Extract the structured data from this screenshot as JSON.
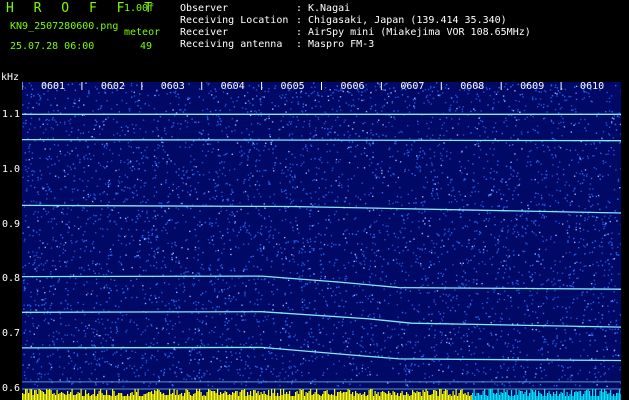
{
  "header": {
    "title": "H R O F F T",
    "version": "1.00f",
    "filename": "KN9_2507280600.png",
    "meteor_label": "meteor",
    "datetime": "25.07.28 06:00",
    "meteor_count": "49"
  },
  "info": [
    {
      "label": "Observer",
      "value": "K.Nagai"
    },
    {
      "label": "Receiving Location",
      "value": "Chigasaki, Japan (139.414 35.340)"
    },
    {
      "label": "Receiver",
      "value": "AirSpy mini (Miakejima VOR 108.65MHz)"
    },
    {
      "label": "Receiving antenna",
      "value": "Maspro FM-3"
    }
  ],
  "separator": ":",
  "chart_data": {
    "type": "heatmap",
    "ylabel": "kHz",
    "yticks": [
      "1.1",
      "1.0",
      "0.9",
      "0.8",
      "0.7",
      "0.6"
    ],
    "xticks": [
      "0601",
      "0602",
      "0603",
      "0604",
      "0605",
      "0606",
      "0607",
      "0608",
      "0609",
      "0610"
    ],
    "ylim": [
      0.58,
      1.16
    ],
    "colors": {
      "background": "#000a66",
      "noise": "#2a6bff",
      "trace": "#8ef6ff",
      "bar": "#ffff00",
      "bar_end": "#00e5ff"
    },
    "traces_khz": [
      {
        "points": [
          [
            0,
            1.101
          ],
          [
            10,
            1.101
          ]
        ]
      },
      {
        "points": [
          [
            0,
            1.055
          ],
          [
            10,
            1.053
          ]
        ]
      },
      {
        "points": [
          [
            0,
            0.935
          ],
          [
            4.5,
            0.933
          ],
          [
            10,
            0.921
          ]
        ]
      },
      {
        "points": [
          [
            0,
            0.805
          ],
          [
            4,
            0.806
          ],
          [
            5.3,
            0.795
          ],
          [
            6.3,
            0.785
          ],
          [
            10,
            0.782
          ]
        ]
      },
      {
        "points": [
          [
            0,
            0.74
          ],
          [
            4,
            0.741
          ],
          [
            5.8,
            0.728
          ],
          [
            6.5,
            0.72
          ],
          [
            10,
            0.713
          ]
        ]
      },
      {
        "points": [
          [
            0,
            0.675
          ],
          [
            4,
            0.676
          ],
          [
            5.5,
            0.662
          ],
          [
            6.3,
            0.655
          ],
          [
            10,
            0.652
          ]
        ]
      },
      {
        "points": [
          [
            0,
            0.613
          ],
          [
            10,
            0.613
          ]
        ]
      },
      {
        "points": [
          [
            0,
            0.6
          ],
          [
            10,
            0.6
          ]
        ]
      }
    ]
  }
}
